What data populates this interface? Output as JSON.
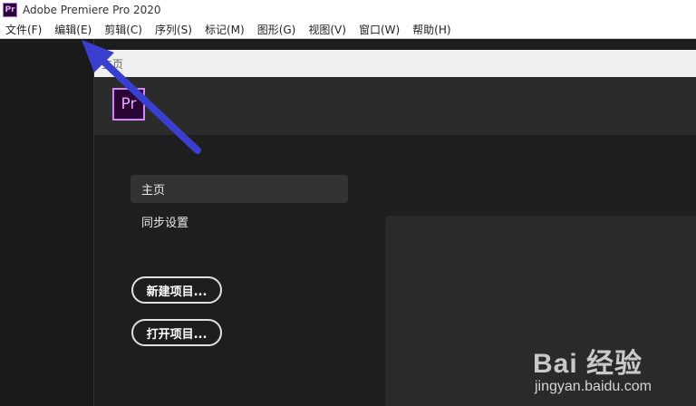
{
  "window": {
    "app_icon_text": "Pr",
    "title": "Adobe Premiere Pro 2020"
  },
  "menubar": {
    "items": [
      "文件(F)",
      "编辑(E)",
      "剪辑(C)",
      "序列(S)",
      "标记(M)",
      "图形(G)",
      "视图(V)",
      "窗口(W)",
      "帮助(H)"
    ]
  },
  "home": {
    "tab_label": "主页",
    "logo_text": "Pr",
    "nav": {
      "home": "主页",
      "sync": "同步设置"
    },
    "buttons": {
      "new_project": "新建项目...",
      "open_project": "打开项目..."
    }
  },
  "watermark": {
    "brand": "Bai 经验",
    "url": "jingyan.baidu.com"
  },
  "colors": {
    "annotation_arrow": "#3a3fd0",
    "premiere_purple": "#d484ff"
  }
}
